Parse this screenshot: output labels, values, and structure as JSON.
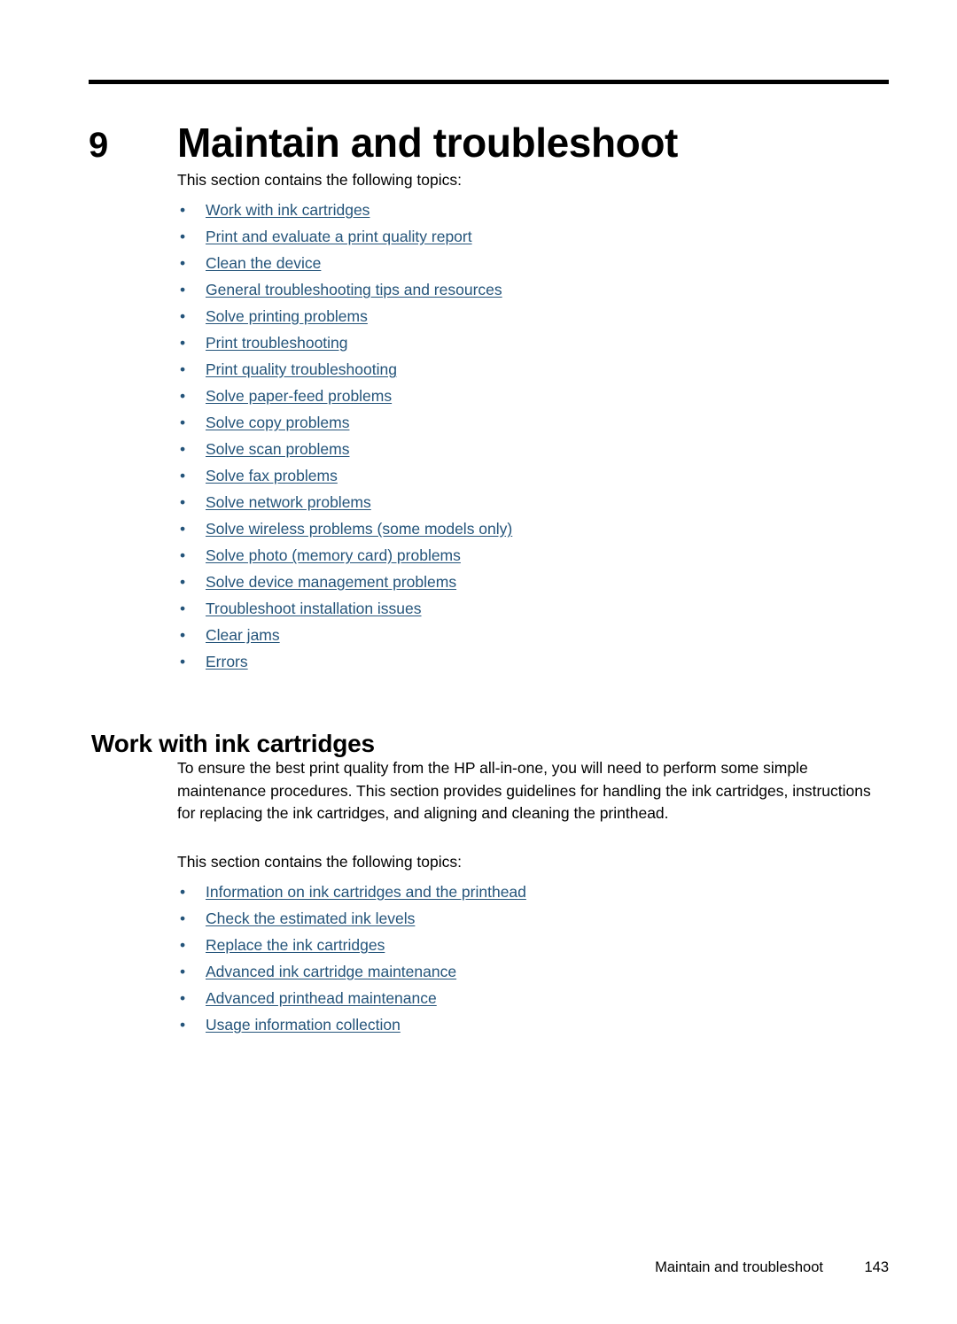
{
  "chapter": {
    "number": "9",
    "title": "Maintain and troubleshoot",
    "intro": "This section contains the following topics:",
    "topics": [
      {
        "label": "Work with ink cartridges"
      },
      {
        "label": "Print and evaluate a print quality report"
      },
      {
        "label": "Clean the device"
      },
      {
        "label": "General troubleshooting tips and resources"
      },
      {
        "label": "Solve printing problems"
      },
      {
        "label": "Print troubleshooting"
      },
      {
        "label": "Print quality troubleshooting"
      },
      {
        "label": "Solve paper-feed problems"
      },
      {
        "label": "Solve copy problems"
      },
      {
        "label": "Solve scan problems"
      },
      {
        "label": "Solve fax problems"
      },
      {
        "label": "Solve network problems"
      },
      {
        "label": "Solve wireless problems (some models only)"
      },
      {
        "label": "Solve photo (memory card) problems"
      },
      {
        "label": "Solve device management problems"
      },
      {
        "label": "Troubleshoot installation issues"
      },
      {
        "label": "Clear jams"
      },
      {
        "label": "Errors"
      }
    ]
  },
  "section": {
    "heading": "Work with ink cartridges",
    "paragraph": "To ensure the best print quality from the HP all-in-one, you will need to perform some simple maintenance procedures. This section provides guidelines for handling the ink cartridges, instructions for replacing the ink cartridges, and aligning and cleaning the printhead.",
    "intro": "This section contains the following topics:",
    "topics": [
      {
        "label": "Information on ink cartridges and the printhead"
      },
      {
        "label": "Check the estimated ink levels"
      },
      {
        "label": "Replace the ink cartridges"
      },
      {
        "label": "Advanced ink cartridge maintenance"
      },
      {
        "label": "Advanced printhead maintenance"
      },
      {
        "label": "Usage information collection"
      }
    ]
  },
  "footer": {
    "title": "Maintain and troubleshoot",
    "page_number": "143"
  },
  "bullet_glyph": "•",
  "colors": {
    "link": "#24547a",
    "text": "#000000",
    "rule": "#000000",
    "background": "#ffffff"
  }
}
